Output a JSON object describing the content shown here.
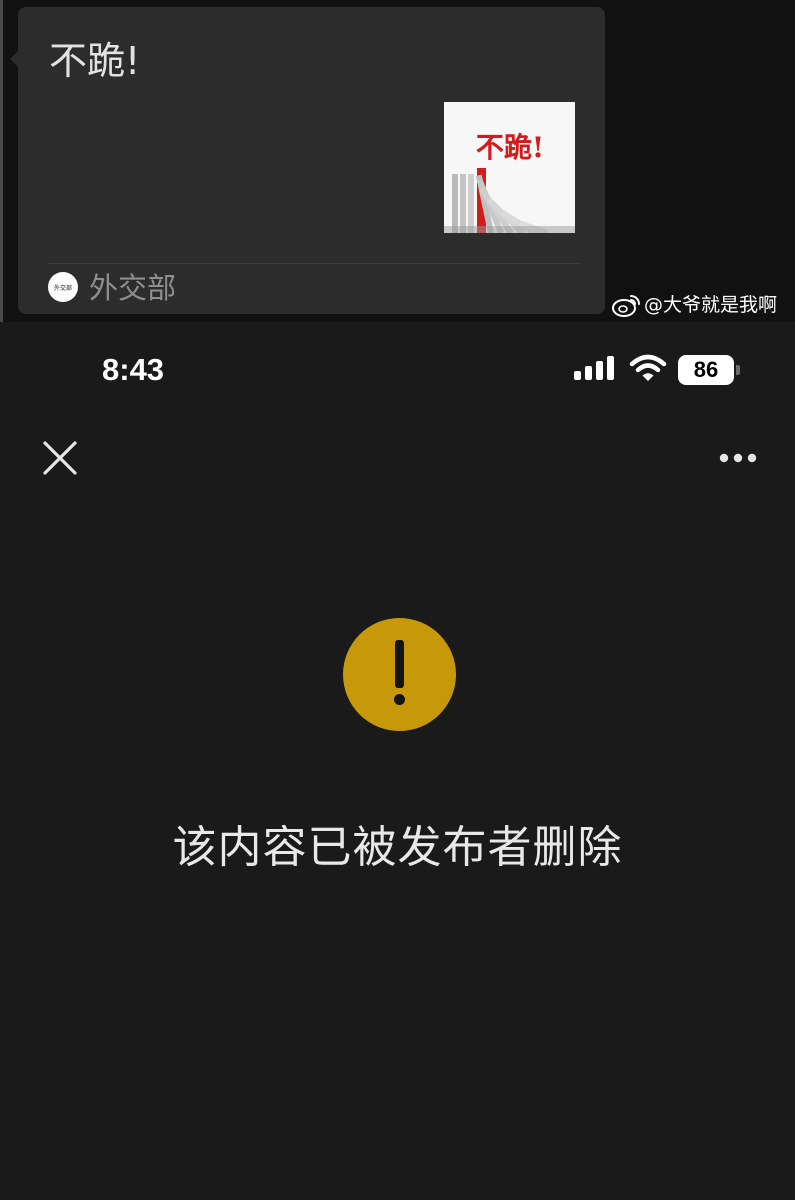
{
  "shared_card": {
    "title": "不跪!",
    "thumbnail_text": "不跪!",
    "source_name": "外交部",
    "source_avatar_text": "外交部"
  },
  "watermark": {
    "icon": "weibo-icon",
    "text": "@大爷就是我啊"
  },
  "status_bar": {
    "time": "8:43",
    "signal_icon": "cellular-signal-icon",
    "wifi_icon": "wifi-icon",
    "battery_level": "86"
  },
  "nav": {
    "close_icon": "close-icon",
    "more_icon": "more-options-icon"
  },
  "content": {
    "warning_icon": "warning-icon",
    "message": "该内容已被发布者删除"
  },
  "colors": {
    "background": "#1a1a1a",
    "card_background": "#2c2c2c",
    "warning_yellow": "#c8980b",
    "thumbnail_red": "#d21c1c"
  }
}
